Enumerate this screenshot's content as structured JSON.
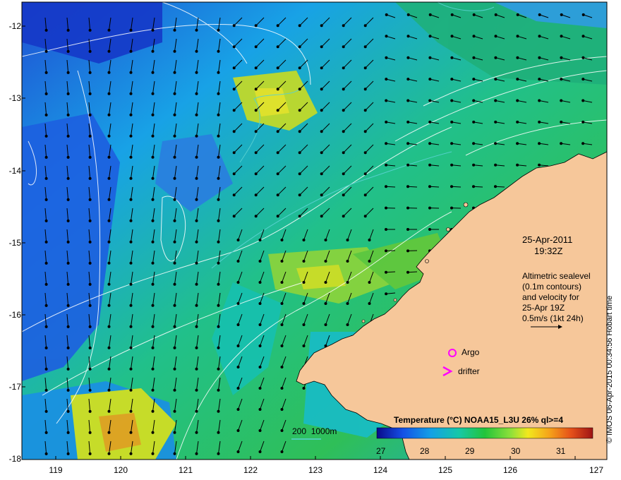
{
  "map": {
    "date": "25-Apr-2011",
    "time": "19:32Z",
    "velocity_note": [
      "Altimetric sealevel",
      "(0.1m contours)",
      "and velocity for",
      "25-Apr 19Z",
      "0.5m/s (1kt 24h)"
    ],
    "legend": {
      "argo": "Argo",
      "drifter": "drifter",
      "depth": "200  1000m"
    },
    "colorbar": {
      "title": "Temperature (°C) NOAA15_L3U 26% ql>=4",
      "ticks": [
        "27",
        "28",
        "29",
        "30",
        "31"
      ]
    },
    "credit": "© IMOS 06-Apr-2015 00:34:56 Hobart time",
    "lat_labels": [
      "-12",
      "-13",
      "-14",
      "-15",
      "-16",
      "-17",
      "-18"
    ],
    "lon_labels": [
      "119",
      "120",
      "121",
      "122",
      "123",
      "124",
      "125",
      "126",
      "127"
    ],
    "colors": {
      "land": "#f6c79a",
      "argo": "#ff00ff",
      "drifter": "#ff00ff",
      "contour": "#ffffff",
      "depth": "#5ad1d1"
    }
  }
}
